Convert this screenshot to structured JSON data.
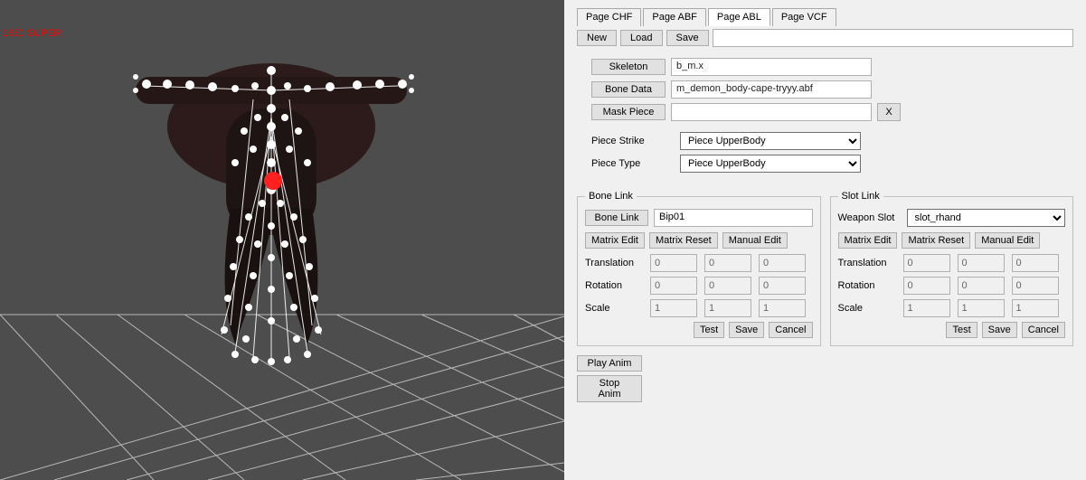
{
  "gpu_text": "1650 SUPER",
  "tabs": [
    "Page CHF",
    "Page ABF",
    "Page ABL",
    "Page VCF"
  ],
  "active_tab": "Page ABL",
  "toolbar": {
    "new": "New",
    "load": "Load",
    "save": "Save"
  },
  "props": {
    "skeleton_label": "Skeleton",
    "skeleton_value": "b_m.x",
    "bonedata_label": "Bone Data",
    "bonedata_value": "m_demon_body-cape-tryyy.abf",
    "maskpiece_label": "Mask Piece",
    "maskpiece_value": "",
    "x": "X"
  },
  "piece": {
    "strike_label": "Piece Strike",
    "strike_value": "Piece UpperBody",
    "type_label": "Piece Type",
    "type_value": "Piece UpperBody"
  },
  "bonelink": {
    "legend": "Bone Link",
    "link_label": "Bone Link",
    "link_value": "Bip01",
    "matrix_edit": "Matrix Edit",
    "matrix_reset": "Matrix Reset",
    "manual_edit": "Manual Edit",
    "translation": "Translation",
    "rotation": "Rotation",
    "scale": "Scale",
    "t": [
      "0",
      "0",
      "0"
    ],
    "r": [
      "0",
      "0",
      "0"
    ],
    "s": [
      "1",
      "1",
      "1"
    ],
    "test": "Test",
    "save": "Save",
    "cancel": "Cancel"
  },
  "slotlink": {
    "legend": "Slot Link",
    "slot_label": "Weapon Slot",
    "slot_value": "slot_rhand",
    "matrix_edit": "Matrix Edit",
    "matrix_reset": "Matrix Reset",
    "manual_edit": "Manual Edit",
    "translation": "Translation",
    "rotation": "Rotation",
    "scale": "Scale",
    "t": [
      "0",
      "0",
      "0"
    ],
    "r": [
      "0",
      "0",
      "0"
    ],
    "s": [
      "1",
      "1",
      "1"
    ],
    "test": "Test",
    "save": "Save",
    "cancel": "Cancel"
  },
  "anim": {
    "play": "Play Anim",
    "stop": "Stop Anim"
  }
}
